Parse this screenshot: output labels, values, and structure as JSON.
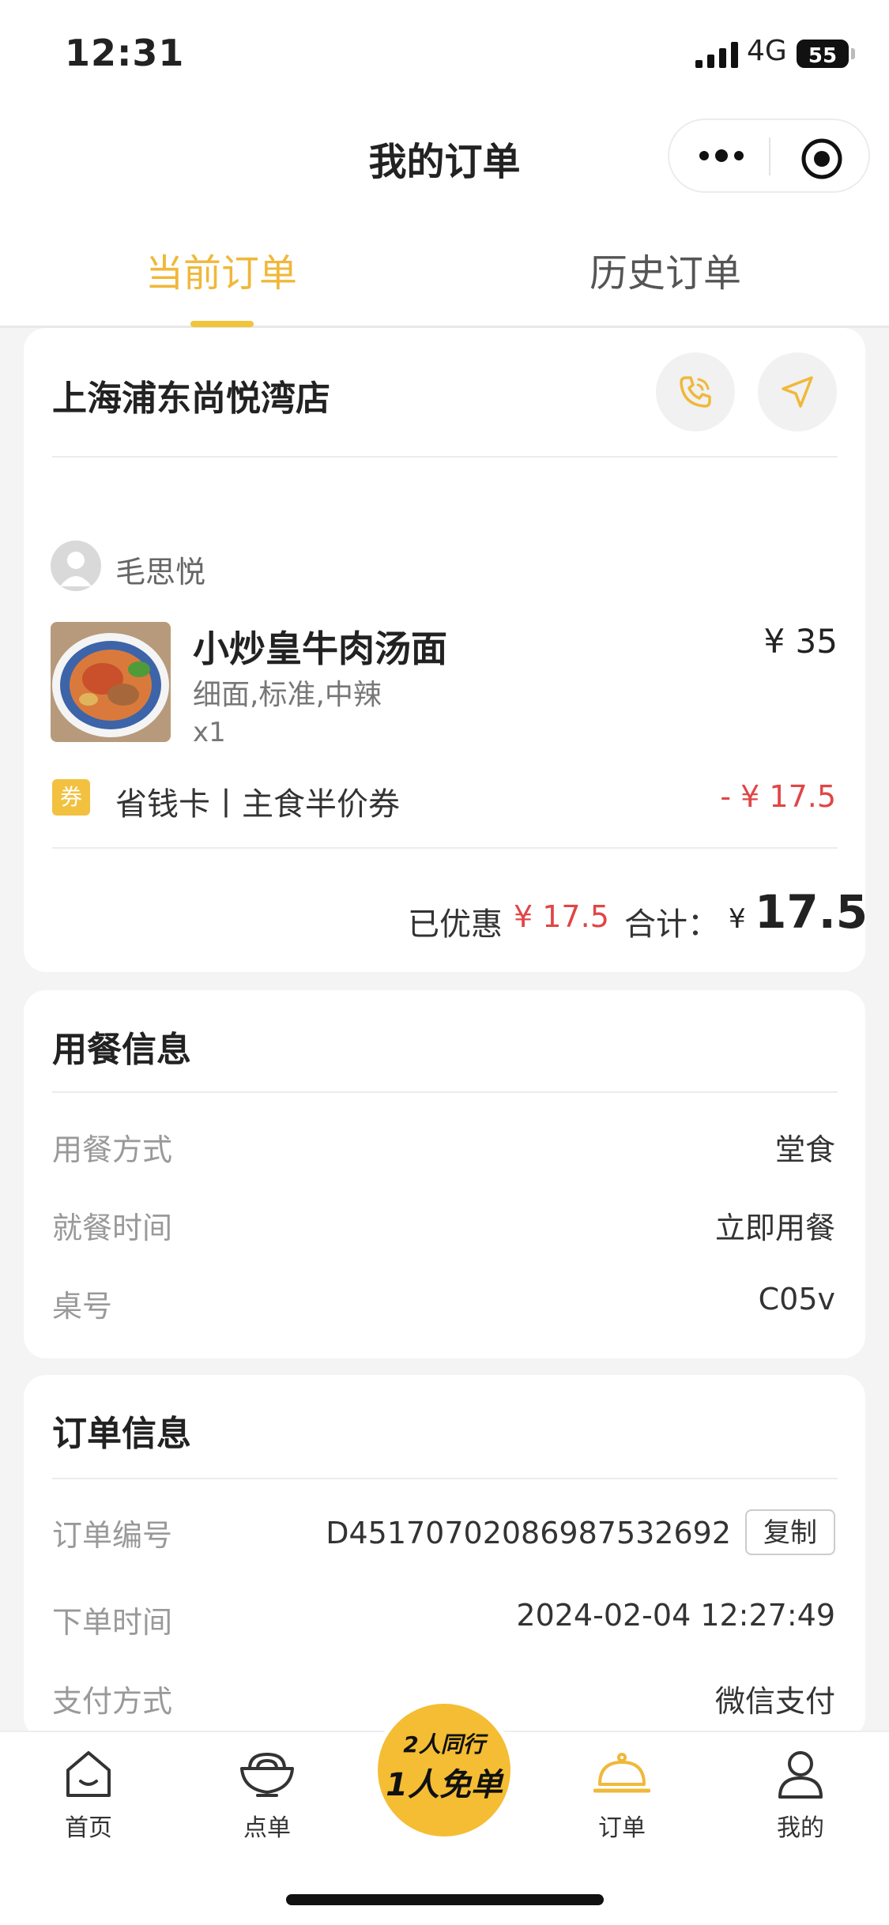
{
  "status_bar": {
    "time": "12:31",
    "network": "4G",
    "battery": "55"
  },
  "header": {
    "title": "我的订单"
  },
  "tabs": [
    {
      "label": "当前订单",
      "active": true
    },
    {
      "label": "历史订单",
      "active": false
    }
  ],
  "order": {
    "store_name": "上海浦东尚悦湾店",
    "user_name": "毛思悦",
    "item": {
      "name": "小炒皇牛肉汤面",
      "price": "¥ 35",
      "spec": "细面,标准,中辣",
      "qty": "x1",
      "image_icon": "beef-noodle-soup-photo"
    },
    "coupon": {
      "badge": "券",
      "text": "省钱卡丨主食半价券",
      "amount": "- ¥ 17.5"
    },
    "summary": {
      "discount_label": "已优惠",
      "discount_amount": "¥ 17.5",
      "total_label": "合计：",
      "currency": "¥",
      "total": "17.5"
    }
  },
  "dining_info": {
    "title": "用餐信息",
    "rows": [
      {
        "label": "用餐方式",
        "value": "堂食"
      },
      {
        "label": "就餐时间",
        "value": "立即用餐"
      },
      {
        "label": "桌号",
        "value": "C05v"
      }
    ]
  },
  "order_info": {
    "title": "订单信息",
    "rows": [
      {
        "label": "订单编号",
        "value": "D45170702086987532692"
      },
      {
        "label": "下单时间",
        "value": "2024-02-04 12:27:49"
      },
      {
        "label": "支付方式",
        "value": "微信支付"
      }
    ],
    "copy_label": "复制"
  },
  "tabbar": {
    "items": [
      {
        "label": "首页",
        "icon": "home-icon"
      },
      {
        "label": "点单",
        "icon": "noodle-bowl-icon"
      },
      {
        "label": "订单",
        "icon": "cloche-icon",
        "active": true
      },
      {
        "label": "我的",
        "icon": "user-icon"
      }
    ],
    "promo": {
      "line1": "2人同行",
      "line2": "1人免单"
    }
  },
  "colors": {
    "accent": "#f0b83a",
    "price_red": "#e04646"
  }
}
